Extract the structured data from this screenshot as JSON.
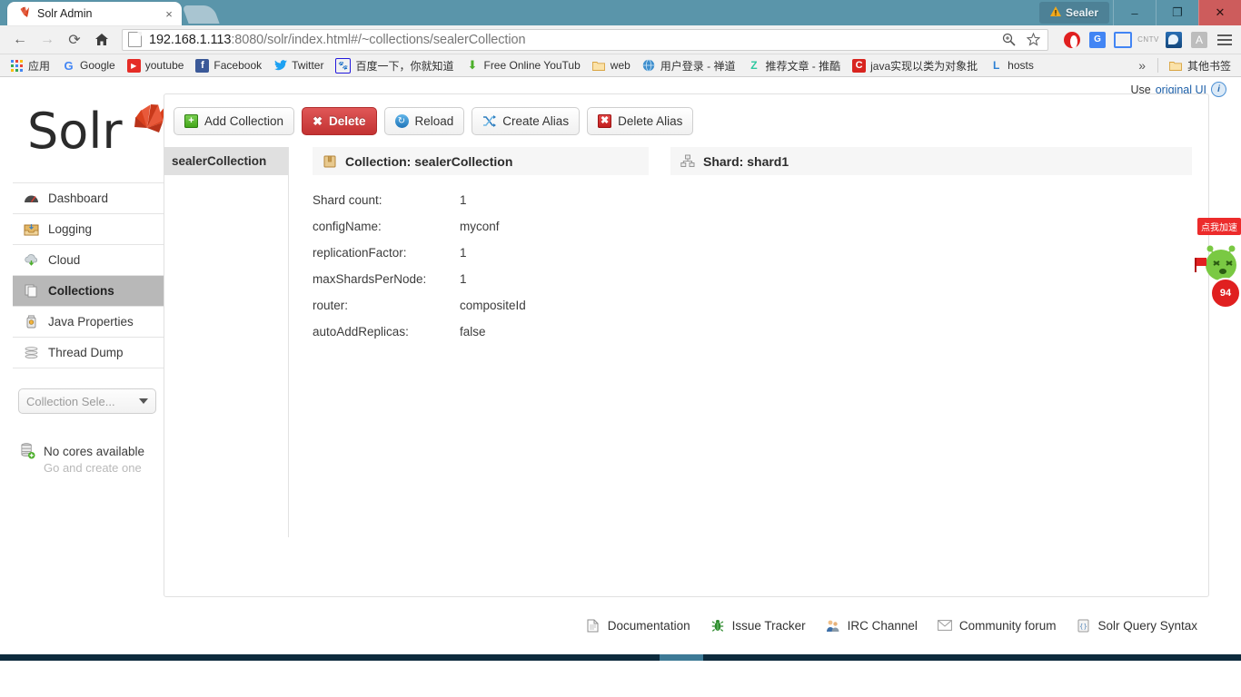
{
  "browser": {
    "tab": {
      "title": "Solr Admin",
      "favicon": "solr-logo-icon",
      "close": "×"
    },
    "window_controls": {
      "sealer_label": "Sealer",
      "sealer_icon": "warning-triangle-icon",
      "minimize": "–",
      "maximize": "❐",
      "close": "✕"
    },
    "nav": {
      "back": "←",
      "forward": "→",
      "reload": "⟳",
      "home": "⌂",
      "zoom_icon": "zoom-search-icon",
      "bookmark_icon": "star-icon"
    },
    "address": {
      "host": "192.168.1.113",
      "rest": ":8080/solr/index.html#/~collections/sealerCollection",
      "full": "192.168.1.113:8080/solr/index.html#/~collections/sealerCollection"
    },
    "extensions": [
      {
        "name": "opera-vpn-icon"
      },
      {
        "name": "google-translate-icon",
        "label": "G"
      },
      {
        "name": "screen-capture-icon"
      },
      {
        "name": "cntv-icon",
        "label": "CNTV"
      },
      {
        "name": "thunder-download-icon"
      },
      {
        "name": "adblock-a-icon",
        "label": "A"
      },
      {
        "name": "chrome-menu-icon"
      }
    ],
    "bookmarks": [
      {
        "label": "应用",
        "icon": "apps-grid-icon"
      },
      {
        "label": "Google",
        "icon": "google-icon",
        "glyph": "G",
        "color": "#4285f4",
        "bg": "transparent"
      },
      {
        "label": "youtube",
        "icon": "youtube-icon",
        "glyph": "▶",
        "color": "#ffffff",
        "bg": "#e52d27"
      },
      {
        "label": "Facebook",
        "icon": "facebook-icon",
        "glyph": "f",
        "color": "#ffffff",
        "bg": "#3b5998"
      },
      {
        "label": "Twitter",
        "icon": "twitter-icon",
        "glyph": "•",
        "color": "#ffffff",
        "bg": "#1da1f2"
      },
      {
        "label": "百度一下，你就知道",
        "icon": "baidu-icon",
        "glyph": "熊",
        "color": "#2319dc",
        "bg": "#ffffff"
      },
      {
        "label": "Free Online YouTub",
        "icon": "download-arrow-icon",
        "glyph": "⬇",
        "color": "#4caf2a",
        "bg": "transparent",
        "faded": true
      },
      {
        "label": "web",
        "icon": "folder-icon",
        "glyph": "▮",
        "color": "#e8b964",
        "bg": "transparent"
      },
      {
        "label": "用户登录 - 禅道",
        "icon": "globe-icon",
        "glyph": "●",
        "color": "#3d8ecd",
        "bg": "transparent"
      },
      {
        "label": "推荐文章 - 推酷",
        "icon": "tuicool-icon",
        "glyph": "Z",
        "color": "#2ec8a0",
        "bg": "#ffffff"
      },
      {
        "label": "java实现以类为对象批",
        "icon": "csdn-icon",
        "glyph": "C",
        "color": "#ffffff",
        "bg": "#d8241f"
      },
      {
        "label": "hosts",
        "icon": "link-l-icon",
        "glyph": "L",
        "color": "#2a7fd4",
        "bg": "#ffffff"
      }
    ],
    "bookmarks_overflow": "»",
    "other_bookmarks": {
      "label": "其他书签",
      "icon": "folder-icon"
    }
  },
  "page": {
    "original_ui": {
      "prefix": "Use",
      "link": "original UI",
      "info_icon": "info-icon",
      "info_glyph": "i"
    },
    "sidebar": {
      "logo_alt": "Solr",
      "logo_text": "Solr",
      "items": [
        {
          "label": "Dashboard",
          "icon": "dashboard-icon",
          "active": false
        },
        {
          "label": "Logging",
          "icon": "logging-icon",
          "active": false
        },
        {
          "label": "Cloud",
          "icon": "cloud-icon",
          "active": false
        },
        {
          "label": "Collections",
          "icon": "collections-icon",
          "active": true
        },
        {
          "label": "Java Properties",
          "icon": "java-properties-icon",
          "active": false
        },
        {
          "label": "Thread Dump",
          "icon": "thread-dump-icon",
          "active": false
        }
      ],
      "collection_selector": {
        "value": "Collection Sele...",
        "caret": "chevron-down-icon"
      },
      "no_cores": {
        "icon": "database-add-icon",
        "line1": "No cores available",
        "line2": "Go and create one"
      }
    },
    "toolbar": [
      {
        "label": "Add Collection",
        "icon": "plus-green-icon",
        "glyph": "+",
        "style": "normal"
      },
      {
        "label": "Delete",
        "icon": "x-white-icon",
        "glyph": "✖",
        "style": "danger"
      },
      {
        "label": "Reload",
        "icon": "reload-blue-icon",
        "glyph": "↻",
        "style": "normal"
      },
      {
        "label": "Create Alias",
        "icon": "alias-blue-icon",
        "glyph": "⤨",
        "style": "normal"
      },
      {
        "label": "Delete Alias",
        "icon": "x-red-icon",
        "glyph": "✖",
        "style": "normal"
      }
    ],
    "collection_list": [
      {
        "label": "sealerCollection",
        "selected": true
      }
    ],
    "collection_panel": {
      "icon": "collection-box-icon",
      "title": "Collection: sealerCollection",
      "properties": [
        {
          "key": "Shard count:",
          "value": "1"
        },
        {
          "key": "configName:",
          "value": "myconf"
        },
        {
          "key": "replicationFactor:",
          "value": "1"
        },
        {
          "key": "maxShardsPerNode:",
          "value": "1"
        },
        {
          "key": "router:",
          "value": "compositeId"
        },
        {
          "key": "autoAddReplicas:",
          "value": "false"
        }
      ]
    },
    "shard_panel": {
      "icon": "shard-tree-icon",
      "title": "Shard: shard1"
    },
    "footer_links": [
      {
        "label": "Documentation",
        "icon": "document-icon"
      },
      {
        "label": "Issue Tracker",
        "icon": "bug-icon"
      },
      {
        "label": "IRC Channel",
        "icon": "people-icon"
      },
      {
        "label": "Community forum",
        "icon": "envelope-icon"
      },
      {
        "label": "Solr Query Syntax",
        "icon": "query-syntax-icon"
      }
    ],
    "mascot_widget": {
      "bubble_text": "点我加速",
      "badge_text": "94"
    }
  }
}
